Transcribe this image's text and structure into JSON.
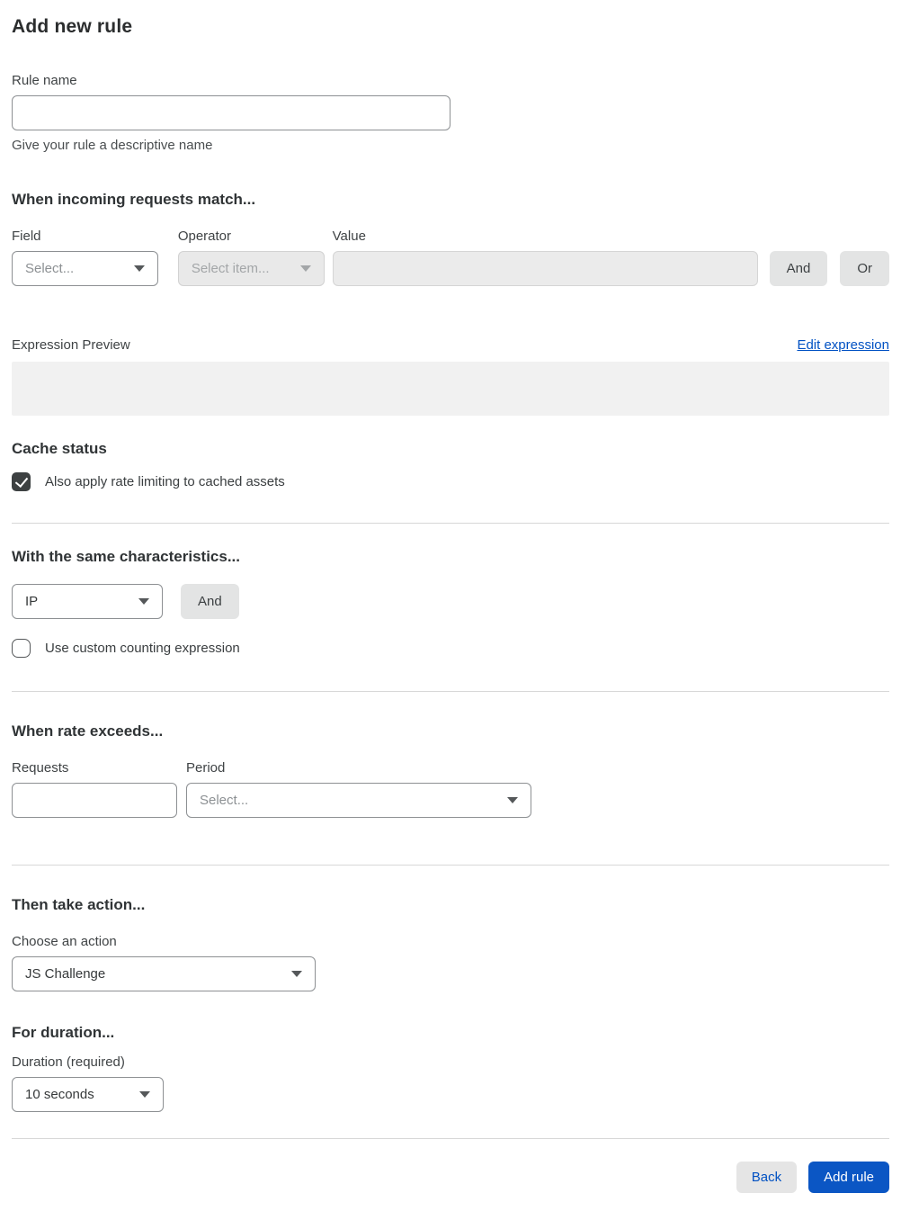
{
  "page": {
    "title": "Add new rule"
  },
  "rule_name": {
    "label": "Rule name",
    "value": "",
    "helper": "Give your rule a descriptive name"
  },
  "match_section": {
    "heading": "When incoming requests match...",
    "field": {
      "label": "Field",
      "selected": "Select..."
    },
    "operator": {
      "label": "Operator",
      "selected": "Select item...",
      "disabled": true
    },
    "value": {
      "label": "Value",
      "value": "",
      "disabled": true
    },
    "and_button": "And",
    "or_button": "Or",
    "expression_preview_label": "Expression Preview",
    "edit_expression_link": "Edit expression",
    "expression_preview_value": ""
  },
  "cache_section": {
    "heading": "Cache status",
    "checkbox": {
      "label": "Also apply rate limiting to cached assets",
      "checked": true
    }
  },
  "characteristics_section": {
    "heading": "With the same characteristics...",
    "characteristic_select": {
      "selected": "IP"
    },
    "and_button": "And",
    "checkbox": {
      "label": "Use custom counting expression",
      "checked": false
    }
  },
  "rate_section": {
    "heading": "When rate exceeds...",
    "requests": {
      "label": "Requests",
      "value": ""
    },
    "period": {
      "label": "Period",
      "selected": "Select..."
    }
  },
  "action_section": {
    "heading": "Then take action...",
    "label": "Choose an action",
    "selected": "JS Challenge"
  },
  "duration_section": {
    "heading": "For duration...",
    "label": "Duration (required)",
    "selected": "10 seconds"
  },
  "footer": {
    "back_button": "Back",
    "add_rule_button": "Add rule"
  },
  "colors": {
    "accent_blue": "#0051c3",
    "primary_button_bg": "#0b56c4",
    "gray_button_bg": "#e3e4e4",
    "disabled_field_bg": "#e9e9e9",
    "preview_box_bg": "#f1f1f1",
    "divider": "#d7d7d7",
    "checkbox_checked_bg": "#3d4142"
  }
}
